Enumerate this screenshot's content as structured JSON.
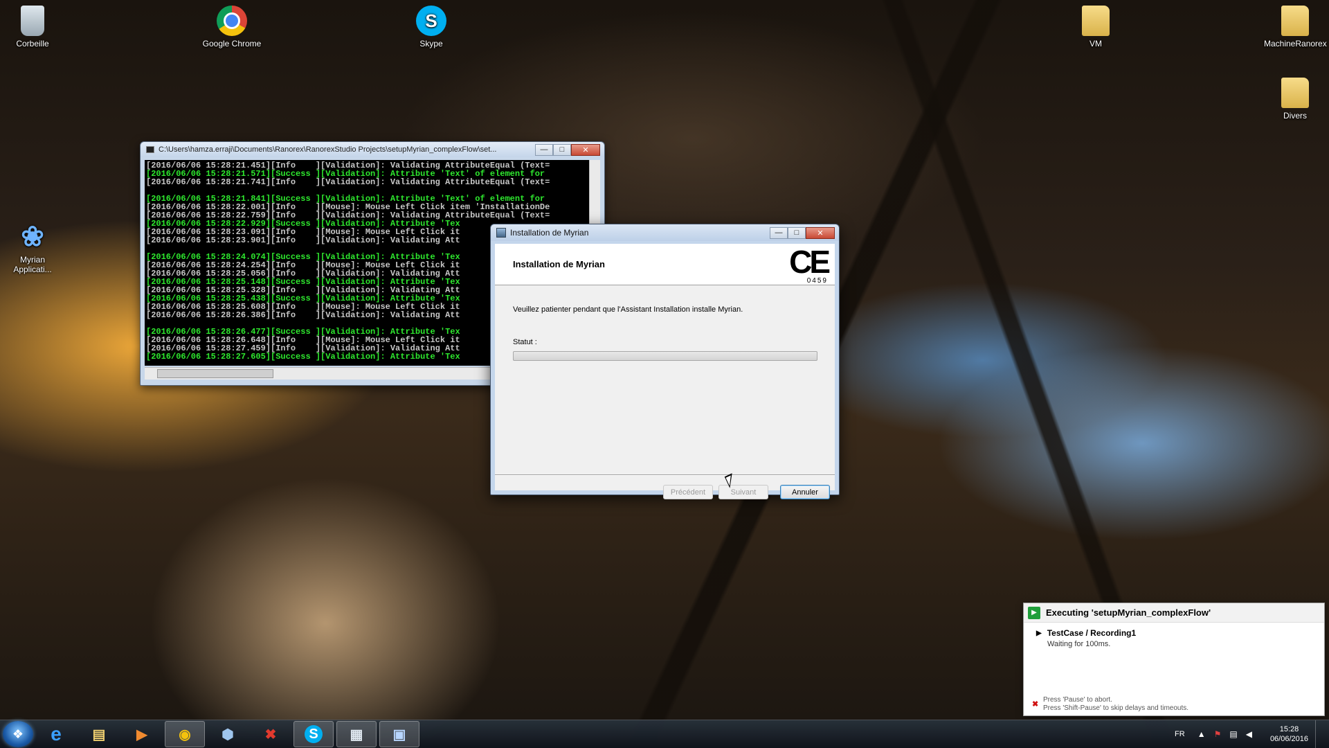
{
  "desktop": {
    "icons": [
      {
        "label": "Corbeille",
        "icon": "recycle-bin-icon"
      },
      {
        "label": "Google Chrome",
        "icon": "chrome-icon"
      },
      {
        "label": "Skype",
        "icon": "skype-icon",
        "glyph": "S"
      },
      {
        "label": "VM",
        "icon": "folder-icon"
      },
      {
        "label": "MachineRanorex",
        "icon": "folder-icon"
      },
      {
        "label": "Divers",
        "icon": "folder-icon"
      },
      {
        "label": "Myrian Applicati...",
        "icon": "butterfly-icon",
        "glyph": "❀"
      }
    ]
  },
  "console": {
    "title": "C:\\Users\\hamza.erraji\\Documents\\Ranorex\\RanorexStudio Projects\\setupMyrian_complexFlow\\set...",
    "lines": [
      {
        "text": "[2016/06/06 15:28:21.451][Info    ][Validation]: Validating AttributeEqual (Text=",
        "ok": false
      },
      {
        "text": "[2016/06/06 15:28:21.571][Success ][Validation]: Attribute 'Text' of element for",
        "ok": true
      },
      {
        "text": "[2016/06/06 15:28:21.741][Info    ][Validation]: Validating AttributeEqual (Text=",
        "ok": false
      },
      {
        "text": "",
        "ok": false
      },
      {
        "text": "[2016/06/06 15:28:21.841][Success ][Validation]: Attribute 'Text' of element for",
        "ok": true
      },
      {
        "text": "[2016/06/06 15:28:22.001][Info    ][Mouse]: Mouse Left Click item 'InstallationDe",
        "ok": false
      },
      {
        "text": "[2016/06/06 15:28:22.759][Info    ][Validation]: Validating AttributeEqual (Text=",
        "ok": false
      },
      {
        "text": "[2016/06/06 15:28:22.929][Success ][Validation]: Attribute 'Tex",
        "ok": true
      },
      {
        "text": "[2016/06/06 15:28:23.091][Info    ][Mouse]: Mouse Left Click it",
        "ok": false
      },
      {
        "text": "[2016/06/06 15:28:23.901][Info    ][Validation]: Validating Att",
        "ok": false
      },
      {
        "text": "",
        "ok": false
      },
      {
        "text": "[2016/06/06 15:28:24.074][Success ][Validation]: Attribute 'Tex",
        "ok": true
      },
      {
        "text": "[2016/06/06 15:28:24.254][Info    ][Mouse]: Mouse Left Click it",
        "ok": false
      },
      {
        "text": "[2016/06/06 15:28:25.056][Info    ][Validation]: Validating Att",
        "ok": false
      },
      {
        "text": "[2016/06/06 15:28:25.148][Success ][Validation]: Attribute 'Tex",
        "ok": true
      },
      {
        "text": "[2016/06/06 15:28:25.328][Info    ][Validation]: Validating Att",
        "ok": false
      },
      {
        "text": "[2016/06/06 15:28:25.438][Success ][Validation]: Attribute 'Tex",
        "ok": true
      },
      {
        "text": "[2016/06/06 15:28:25.608][Info    ][Mouse]: Mouse Left Click it",
        "ok": false
      },
      {
        "text": "[2016/06/06 15:28:26.386][Info    ][Validation]: Validating Att",
        "ok": false
      },
      {
        "text": "",
        "ok": false
      },
      {
        "text": "[2016/06/06 15:28:26.477][Success ][Validation]: Attribute 'Tex",
        "ok": true
      },
      {
        "text": "[2016/06/06 15:28:26.648][Info    ][Mouse]: Mouse Left Click it",
        "ok": false
      },
      {
        "text": "[2016/06/06 15:28:27.459][Info    ][Validation]: Validating Att",
        "ok": false
      },
      {
        "text": "[2016/06/06 15:28:27.605][Success ][Validation]: Attribute 'Tex",
        "ok": true
      }
    ]
  },
  "dialog": {
    "title": "Installation de Myrian",
    "heading": "Installation de Myrian",
    "ce_mark": "CE",
    "ce_number": "0459",
    "message": "Veuillez patienter pendant que l'Assistant Installation installe Myrian.",
    "status_label": "Statut :",
    "progress_fraction": 0,
    "buttons": {
      "back": "Précédent",
      "next": "Suivant",
      "cancel": "Annuler"
    }
  },
  "exec_panel": {
    "title": "Executing 'setupMyrian_complexFlow'",
    "testcase": "TestCase / Recording1",
    "wait": "Waiting for 100ms.",
    "hint_pause": "Press 'Pause' to abort.",
    "hint_shift": "Press 'Shift-Pause' to skip delays and timeouts."
  },
  "taskbar": {
    "apps": [
      {
        "icon": "internet-explorer-icon",
        "glyph": "e"
      },
      {
        "icon": "file-explorer-icon",
        "glyph": "▤"
      },
      {
        "icon": "media-player-icon",
        "glyph": "▶"
      },
      {
        "icon": "chrome-icon",
        "glyph": "◉"
      },
      {
        "icon": "virtualbox-icon",
        "glyph": "⬢"
      },
      {
        "icon": "ranorex-icon",
        "glyph": "✖"
      },
      {
        "icon": "skype-icon",
        "glyph": "S"
      },
      {
        "icon": "installer-icon",
        "glyph": "▦"
      },
      {
        "icon": "ranorex-runner-icon",
        "glyph": "▣"
      }
    ],
    "language": "FR",
    "time": "15:28",
    "date": "06/06/2016"
  }
}
